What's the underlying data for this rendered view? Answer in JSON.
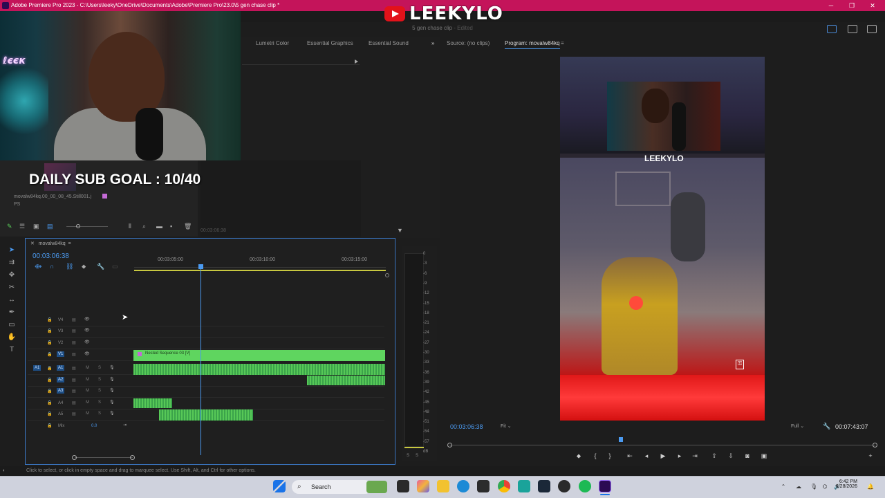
{
  "window": {
    "title": "Adobe Premiere Pro 2023 - C:\\Users\\leeky\\OneDrive\\Documents\\Adobe\\Premiere Pro\\23.0\\5 gen chase clip *",
    "minimize": "─",
    "maximize": "❐",
    "close": "✕"
  },
  "overlay": {
    "channel_name": "LEEKYLO",
    "webcam_tag": "ℓєєк",
    "sub_goal": "DAILY SUB GOAL : 10/40"
  },
  "document": {
    "name": "5 gen chase clip",
    "status": "- Edited"
  },
  "panels": {
    "tabs": [
      "Lumetri Color",
      "Essential Graphics",
      "Essential Sound"
    ],
    "more": "»",
    "project_item": "movalw84kq.00_00_08_45.Still001.j",
    "project_item_sub": "PS",
    "source_tc": "00:03:06:38"
  },
  "monitors": {
    "source_tab": "Source: (no clips)",
    "program_tab": "Program: movalw84kq",
    "program_menu": "≡",
    "timecode": "00:03:06:38",
    "fit": "Fit",
    "full": "Full",
    "duration": "00:07:43:07",
    "video_title": "LEEKYLO"
  },
  "timeline": {
    "sequence_name": "movalw84kq",
    "timecode": "00:03:06:38",
    "ruler": [
      "00:03:05:00",
      "00:03:10:00",
      "00:03:15:00"
    ],
    "video_tracks": [
      "V4",
      "V3",
      "V2",
      "V1"
    ],
    "audio_tracks": [
      "A1",
      "A2",
      "A3",
      "A4",
      "A5"
    ],
    "mix_label": "Mix",
    "mix_value": "0.0",
    "clip_name": "Nested Sequence 03 [V]",
    "m_label": "M",
    "s_label": "S"
  },
  "meters": {
    "db_scale": [
      "0",
      "-3",
      "-6",
      "-9",
      "-12",
      "-15",
      "-18",
      "-21",
      "-24",
      "-27",
      "-30",
      "-33",
      "-36",
      "-39",
      "-42",
      "-45",
      "-48",
      "-51",
      "-54",
      "-57",
      "dB"
    ],
    "solo": "S"
  },
  "status_bar": {
    "hint": "Click to select, or click in empty space and drag to marquee select. Use Shift, Alt, and Ctrl for other options."
  },
  "taskbar": {
    "search_label": "Search",
    "time": "6:42 PM",
    "date": "2/28/2026"
  },
  "colors": {
    "titlebar": "#c4145a",
    "accent_blue": "#4b9af0",
    "clip_green": "#5fd55f"
  }
}
